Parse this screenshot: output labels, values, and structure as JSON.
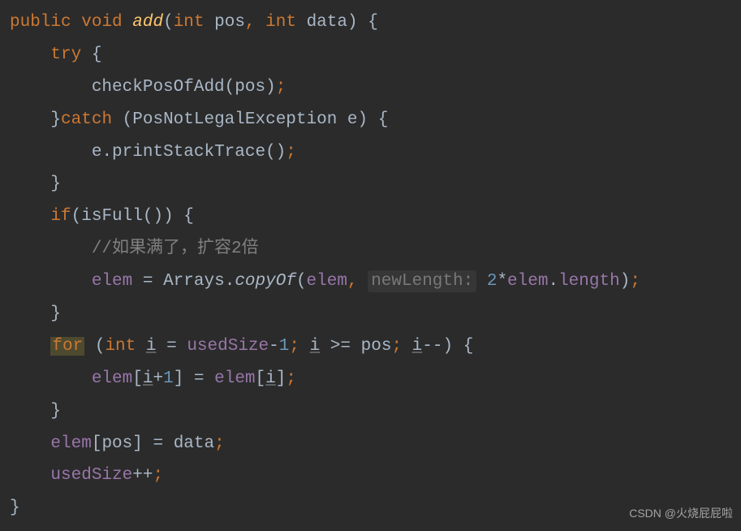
{
  "code": {
    "line1": {
      "kw1": "public",
      "kw2": "void",
      "fname": "add",
      "p1type": "int",
      "p1": "pos",
      "p2type": "int",
      "p2": "data"
    },
    "line2": {
      "kw": "try"
    },
    "line3": {
      "call": "checkPosOfAdd",
      "arg": "pos"
    },
    "line4": {
      "kw": "catch",
      "extype": "PosNotLegalException",
      "exvar": "e"
    },
    "line5": {
      "obj": "e",
      "method": "printStackTrace"
    },
    "line7": {
      "kw": "if",
      "call": "isFull"
    },
    "line8": {
      "comment": "//如果满了，扩容2倍"
    },
    "line9": {
      "lhs": "elem",
      "cls": "Arrays",
      "method": "copyOf",
      "arg1": "elem",
      "hint": "newLength:",
      "num": "2",
      "op": "*",
      "arg2a": "elem",
      "arg2b": "length"
    },
    "line11": {
      "kw": "for",
      "type": "int",
      "var": "i",
      "init": "usedSize",
      "num1": "1",
      "cond": "pos",
      "var2": "i",
      "var3": "i"
    },
    "line12": {
      "arr": "elem",
      "idx1": "i",
      "num": "1",
      "arr2": "elem",
      "idx2": "i"
    },
    "line14": {
      "arr": "elem",
      "idx": "pos",
      "rhs": "data"
    },
    "line15": {
      "var": "usedSize"
    }
  },
  "watermark": "CSDN @火烧屁屁啦"
}
